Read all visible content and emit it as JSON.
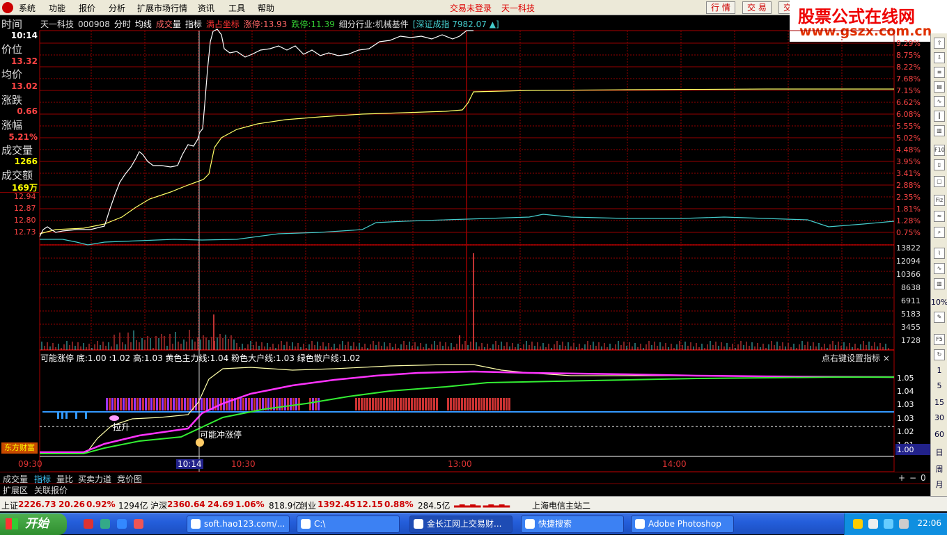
{
  "menu": {
    "items": [
      "系统",
      "功能",
      "报价",
      "分析",
      "扩展市场行情",
      "资讯",
      "工具",
      "帮助"
    ],
    "status": "交易未登录",
    "stock_name": "天一科技",
    "buttons": [
      "行 情",
      "交 易",
      "交"
    ]
  },
  "brand": {
    "title": "股票公式在线网",
    "url": "www.gszx.com.cn"
  },
  "left_panel": {
    "time_label": "时间",
    "time_value": "10:14",
    "price_label": "价位",
    "price_value": "13.32",
    "avg_label": "均价",
    "avg_value": "13.02",
    "change_label": "涨跌",
    "change_value": "0.66",
    "pct_label": "涨幅",
    "pct_value": "5.21%",
    "vol_label": "成交量",
    "vol_value": "1266",
    "amount_label": "成交额",
    "amount_value": "169万",
    "axis_prices": [
      "12.94",
      "12.87",
      "12.80",
      "12.73"
    ]
  },
  "chart_header": {
    "stock": "天一科技",
    "code": "000908",
    "mode": "分时",
    "avg_line": "均线",
    "volume_pre": "成交",
    "volume_post": "量",
    "indicator": "指标",
    "full_axis": "满占坐标",
    "limit_up": "涨停:13.93",
    "limit_down": "跌停:11.39",
    "industry": "细分行业:机械基件",
    "index": "[深证成指 7982.07 ▲]"
  },
  "right_axis_pct": [
    "9.29%",
    "8.75%",
    "8.22%",
    "7.68%",
    "7.15%",
    "6.62%",
    "6.08%",
    "5.55%",
    "5.02%",
    "4.48%",
    "3.95%",
    "3.41%",
    "2.88%",
    "2.35%",
    "1.81%",
    "1.28%",
    "0.75%"
  ],
  "right_axis_vol": [
    "13822",
    "12094",
    "10366",
    "8638",
    "6911",
    "5183",
    "3455",
    "1728"
  ],
  "right_axis_ind": [
    "1.05",
    "1.04",
    "1.03",
    "1.03",
    "1.02",
    "1.01",
    "1.00"
  ],
  "indicator": {
    "header": "可能涨停  底:1.00  :1.02  高:1.03  黄色主力线:1.04  粉色大户线:1.03  绿色散户线:1.02",
    "hint": "点右键设置指标  ×",
    "label_rise": "拉升",
    "label_limit": "可能冲涨停"
  },
  "time_axis": [
    "09:30",
    "10:14",
    "10:30",
    "13:00",
    "14:00"
  ],
  "dfcf_label": "东方财富",
  "tabs": [
    "成交量",
    "指标",
    "量比",
    "买卖力道",
    "竞价图"
  ],
  "tab_controls": [
    "+",
    "−",
    "0"
  ],
  "ext_tabs": [
    "扩展区",
    "关联报价"
  ],
  "index_bar": {
    "sh_name": "上证",
    "sh_value": "2226.73",
    "sh_change": "20.26",
    "sh_pct": "0.92%",
    "sh_amount": "1294亿",
    "hs_name": "沪深",
    "hs_value": "2360.64",
    "hs_change": "24.69",
    "hs_pct": "1.06%",
    "hs_amount": "818.9亿",
    "cy_name": "创业",
    "cy_value": "1392.45",
    "cy_change": "12.15",
    "cy_pct": "0.88%",
    "cy_amount": "284.5亿",
    "server": "上海电信主站二"
  },
  "right_toolbar": [
    "F10",
    "Fiz",
    "10%",
    "F5",
    "1",
    "5",
    "15",
    "30",
    "60",
    "日",
    "周",
    "月"
  ],
  "taskbar": {
    "start": "开始",
    "tasks": [
      "soft.hao123.com/...",
      "C:\\",
      "金长江网上交易财...",
      "快捷搜索",
      "Adobe Photoshop"
    ],
    "clock": "22:06"
  },
  "chart_data": {
    "type": "line",
    "x_range": [
      "09:30",
      "15:00"
    ],
    "series": [
      {
        "label": "price",
        "color": "#ffffff"
      },
      {
        "label": "avg",
        "color": "#ffff66"
      },
      {
        "label": "index",
        "color": "#44cccc"
      }
    ],
    "price_axis": {
      "min": 12.66,
      "max": 14.02
    },
    "volume_max": 13822,
    "indicator_range": [
      1.0,
      1.05
    ],
    "indicator_lines": [
      {
        "name": "黄色主力线",
        "color": "#ffffaa"
      },
      {
        "name": "粉色大户线",
        "color": "#ff33ff"
      },
      {
        "name": "绿色散户线",
        "color": "#33ee33"
      }
    ]
  }
}
